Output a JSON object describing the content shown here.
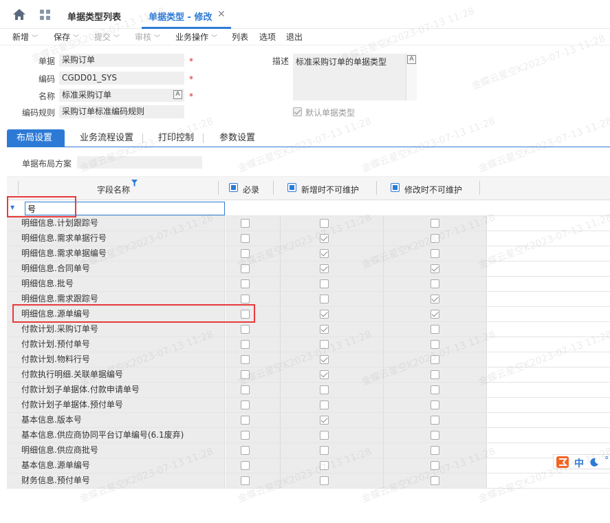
{
  "tabs": {
    "list": "单据类型列表",
    "edit": "单据类型 - 修改",
    "close": "✕"
  },
  "toolbar": [
    {
      "label": "新增",
      "chev": true,
      "disabled": false
    },
    {
      "label": "保存",
      "chev": true,
      "disabled": false
    },
    {
      "label": "提交",
      "chev": true,
      "disabled": true
    },
    {
      "label": "审核",
      "chev": true,
      "disabled": true
    },
    {
      "label": "业务操作",
      "chev": true,
      "disabled": false
    },
    {
      "label": "列表",
      "chev": false,
      "disabled": false
    },
    {
      "label": "选项",
      "chev": false,
      "disabled": false
    },
    {
      "label": "退出",
      "chev": false,
      "disabled": false
    }
  ],
  "form": {
    "doc_label": "单据",
    "doc_value": "采购订单",
    "code_label": "编码",
    "code_value": "CGDD01_SYS",
    "name_label": "名称",
    "name_value": "标准采购订单",
    "rule_label": "编码规则",
    "rule_value": "采购订单标准编码规则",
    "desc_label": "描述",
    "desc_value": "标准采购订单的单据类型",
    "default_label": "默认单据类型",
    "default_checked": true,
    "required_mark": "*",
    "lang_btn": "A"
  },
  "content_tabs": [
    "布局设置",
    "业务流程设置",
    "打印控制",
    "参数设置"
  ],
  "scheme_label": "单据布局方案",
  "columns": {
    "field": "字段名称",
    "required": "必录",
    "no_add": "新增时不可维护",
    "no_edit": "修改时不可维护"
  },
  "filter_value": "号",
  "rows": [
    {
      "name": "明细信息.计划跟踪号",
      "req": false,
      "add": false,
      "edit": false
    },
    {
      "name": "明细信息.需求单据行号",
      "req": false,
      "add": true,
      "edit": false
    },
    {
      "name": "明细信息.需求单据编号",
      "req": false,
      "add": true,
      "edit": false
    },
    {
      "name": "明细信息.合同单号",
      "req": false,
      "add": true,
      "edit": true
    },
    {
      "name": "明细信息.批号",
      "req": false,
      "add": false,
      "edit": false
    },
    {
      "name": "明细信息.需求跟踪号",
      "req": false,
      "add": false,
      "edit": true
    },
    {
      "name": "明细信息.源单编号",
      "req": false,
      "add": true,
      "edit": true
    },
    {
      "name": "付款计划.采购订单号",
      "req": false,
      "add": true,
      "edit": false
    },
    {
      "name": "付款计划.预付单号",
      "req": false,
      "add": false,
      "edit": false
    },
    {
      "name": "付款计划.物料行号",
      "req": false,
      "add": true,
      "edit": false
    },
    {
      "name": "付款执行明细.关联单据编号",
      "req": false,
      "add": true,
      "edit": false
    },
    {
      "name": "付款计划子单据体.付款申请单号",
      "req": false,
      "add": false,
      "edit": false
    },
    {
      "name": "付款计划子单据体.预付单号",
      "req": false,
      "add": false,
      "edit": false
    },
    {
      "name": "基本信息.版本号",
      "req": false,
      "add": true,
      "edit": false
    },
    {
      "name": "基本信息.供应商协同平台订单编号(6.1废弃)",
      "req": false,
      "add": false,
      "edit": false
    },
    {
      "name": "明细信息.供应商批号",
      "req": false,
      "add": false,
      "edit": false
    },
    {
      "name": "基本信息.源单编号",
      "req": false,
      "add": false,
      "edit": false
    },
    {
      "name": "财务信息.预付单号",
      "req": false,
      "add": false,
      "edit": false
    }
  ],
  "watermark": "金蝶云星空K2023-07-13 11:28",
  "ime": {
    "chinese": "中"
  },
  "colors": {
    "accent": "#2d7ad6",
    "highlight": "#e8393b"
  }
}
